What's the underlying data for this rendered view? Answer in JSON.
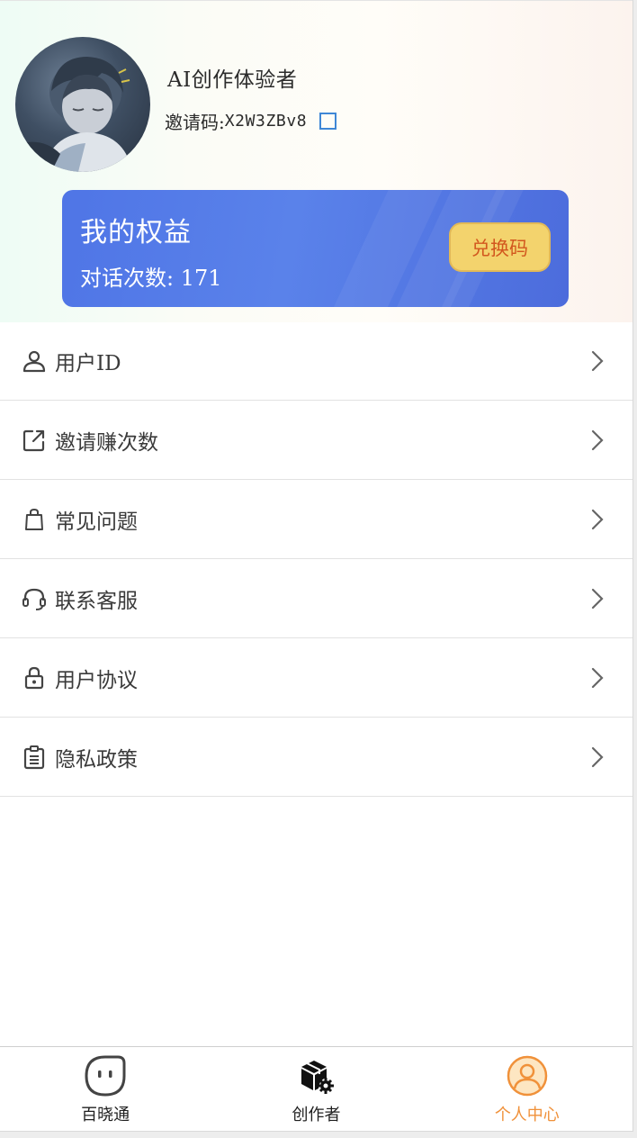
{
  "profile": {
    "username": "AI创作体验者",
    "invite_prefix": "邀请码:",
    "invite_code": "X2W3ZBv8"
  },
  "benefits": {
    "title": "我的权益",
    "count_label": "对话次数: 171",
    "redeem_label": "兑换码"
  },
  "menu": {
    "items": [
      {
        "label": "用户ID",
        "icon": "user-icon"
      },
      {
        "label": "邀请赚次数",
        "icon": "share-icon"
      },
      {
        "label": "常见问题",
        "icon": "bag-icon"
      },
      {
        "label": "联系客服",
        "icon": "headset-icon"
      },
      {
        "label": "用户协议",
        "icon": "lock-icon"
      },
      {
        "label": "隐私政策",
        "icon": "clipboard-icon"
      }
    ]
  },
  "tabbar": {
    "tabs": [
      {
        "label": "百晓通",
        "icon": "chat-face-icon",
        "active": false
      },
      {
        "label": "创作者",
        "icon": "box-gear-icon",
        "active": false
      },
      {
        "label": "个人中心",
        "icon": "person-circle-icon",
        "active": true
      }
    ]
  },
  "colors": {
    "card_blue": "#5278e6",
    "redeem_bg": "#f3d36d",
    "redeem_text": "#d2571e",
    "active_tab": "#f0913a",
    "copy_icon": "#3f87d6"
  }
}
